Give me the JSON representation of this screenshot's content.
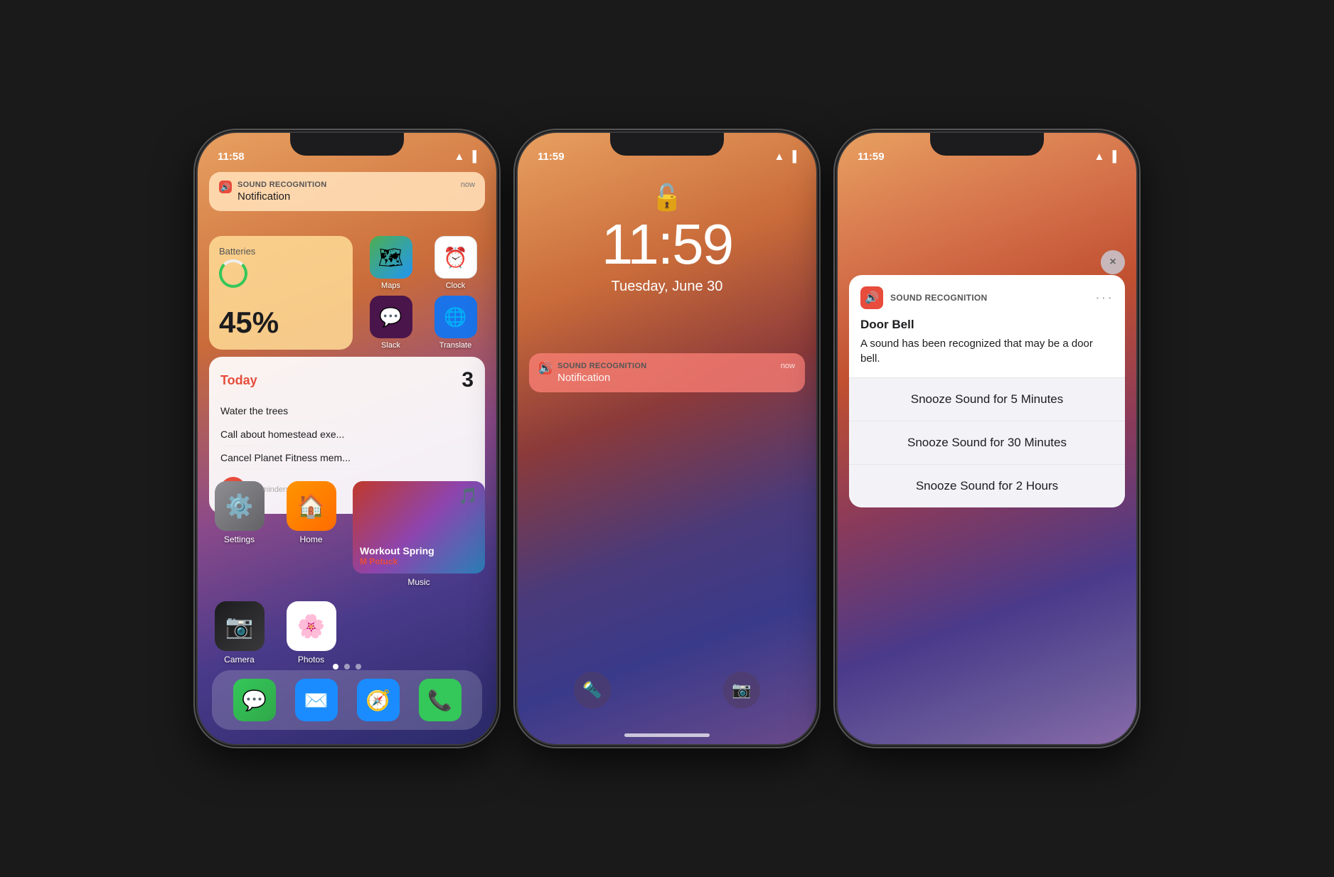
{
  "phone1": {
    "status": {
      "time": "11:58",
      "signal": "wifi",
      "battery": "full"
    },
    "notification": {
      "app": "SOUND RECOGNITION",
      "time": "now",
      "message": "Notification"
    },
    "battery_widget": {
      "percentage": "45%",
      "label": "Batteries"
    },
    "apps_top": [
      {
        "name": "Maps",
        "label": "Maps"
      },
      {
        "name": "Clock",
        "label": "Clock"
      },
      {
        "name": "Slack",
        "label": "Slack"
      },
      {
        "name": "Translate",
        "label": "Translate"
      }
    ],
    "reminders": {
      "header": "Today",
      "count": "3",
      "items": [
        "Water the trees",
        "Call about homestead exe...",
        "Cancel Planet Fitness mem..."
      ],
      "label": "Reminders"
    },
    "apps_main": [
      {
        "name": "Settings",
        "label": "Settings"
      },
      {
        "name": "Home",
        "label": "Home"
      },
      {
        "name": "Music",
        "label": "Music"
      },
      {
        "name": "Camera",
        "label": "Camera"
      },
      {
        "name": "Photos",
        "label": "Photos"
      }
    ],
    "music": {
      "title": "Workout Spring",
      "artist": "M Potuck"
    },
    "dock": [
      {
        "name": "Messages",
        "label": "Messages"
      },
      {
        "name": "Mail",
        "label": "Mail"
      },
      {
        "name": "Safari",
        "label": "Safari"
      },
      {
        "name": "Phone",
        "label": "Phone"
      }
    ]
  },
  "phone2": {
    "status": {
      "time": "11:59",
      "signal": "wifi",
      "battery": "full"
    },
    "lock": {
      "time": "11:59",
      "date": "Tuesday, June 30"
    },
    "notification": {
      "app": "SOUND RECOGNITION",
      "time": "now",
      "message": "Notification"
    }
  },
  "phone3": {
    "status": {
      "time": "11:59",
      "signal": "wifi",
      "battery": "full"
    },
    "notification": {
      "app": "SOUND RECOGNITION",
      "title": "Door Bell",
      "description": "A sound has been recognized that may be a door bell."
    },
    "actions": [
      "Snooze Sound for 5 Minutes",
      "Snooze Sound for 30 Minutes",
      "Snooze Sound for 2 Hours"
    ],
    "close_btn": "×"
  }
}
